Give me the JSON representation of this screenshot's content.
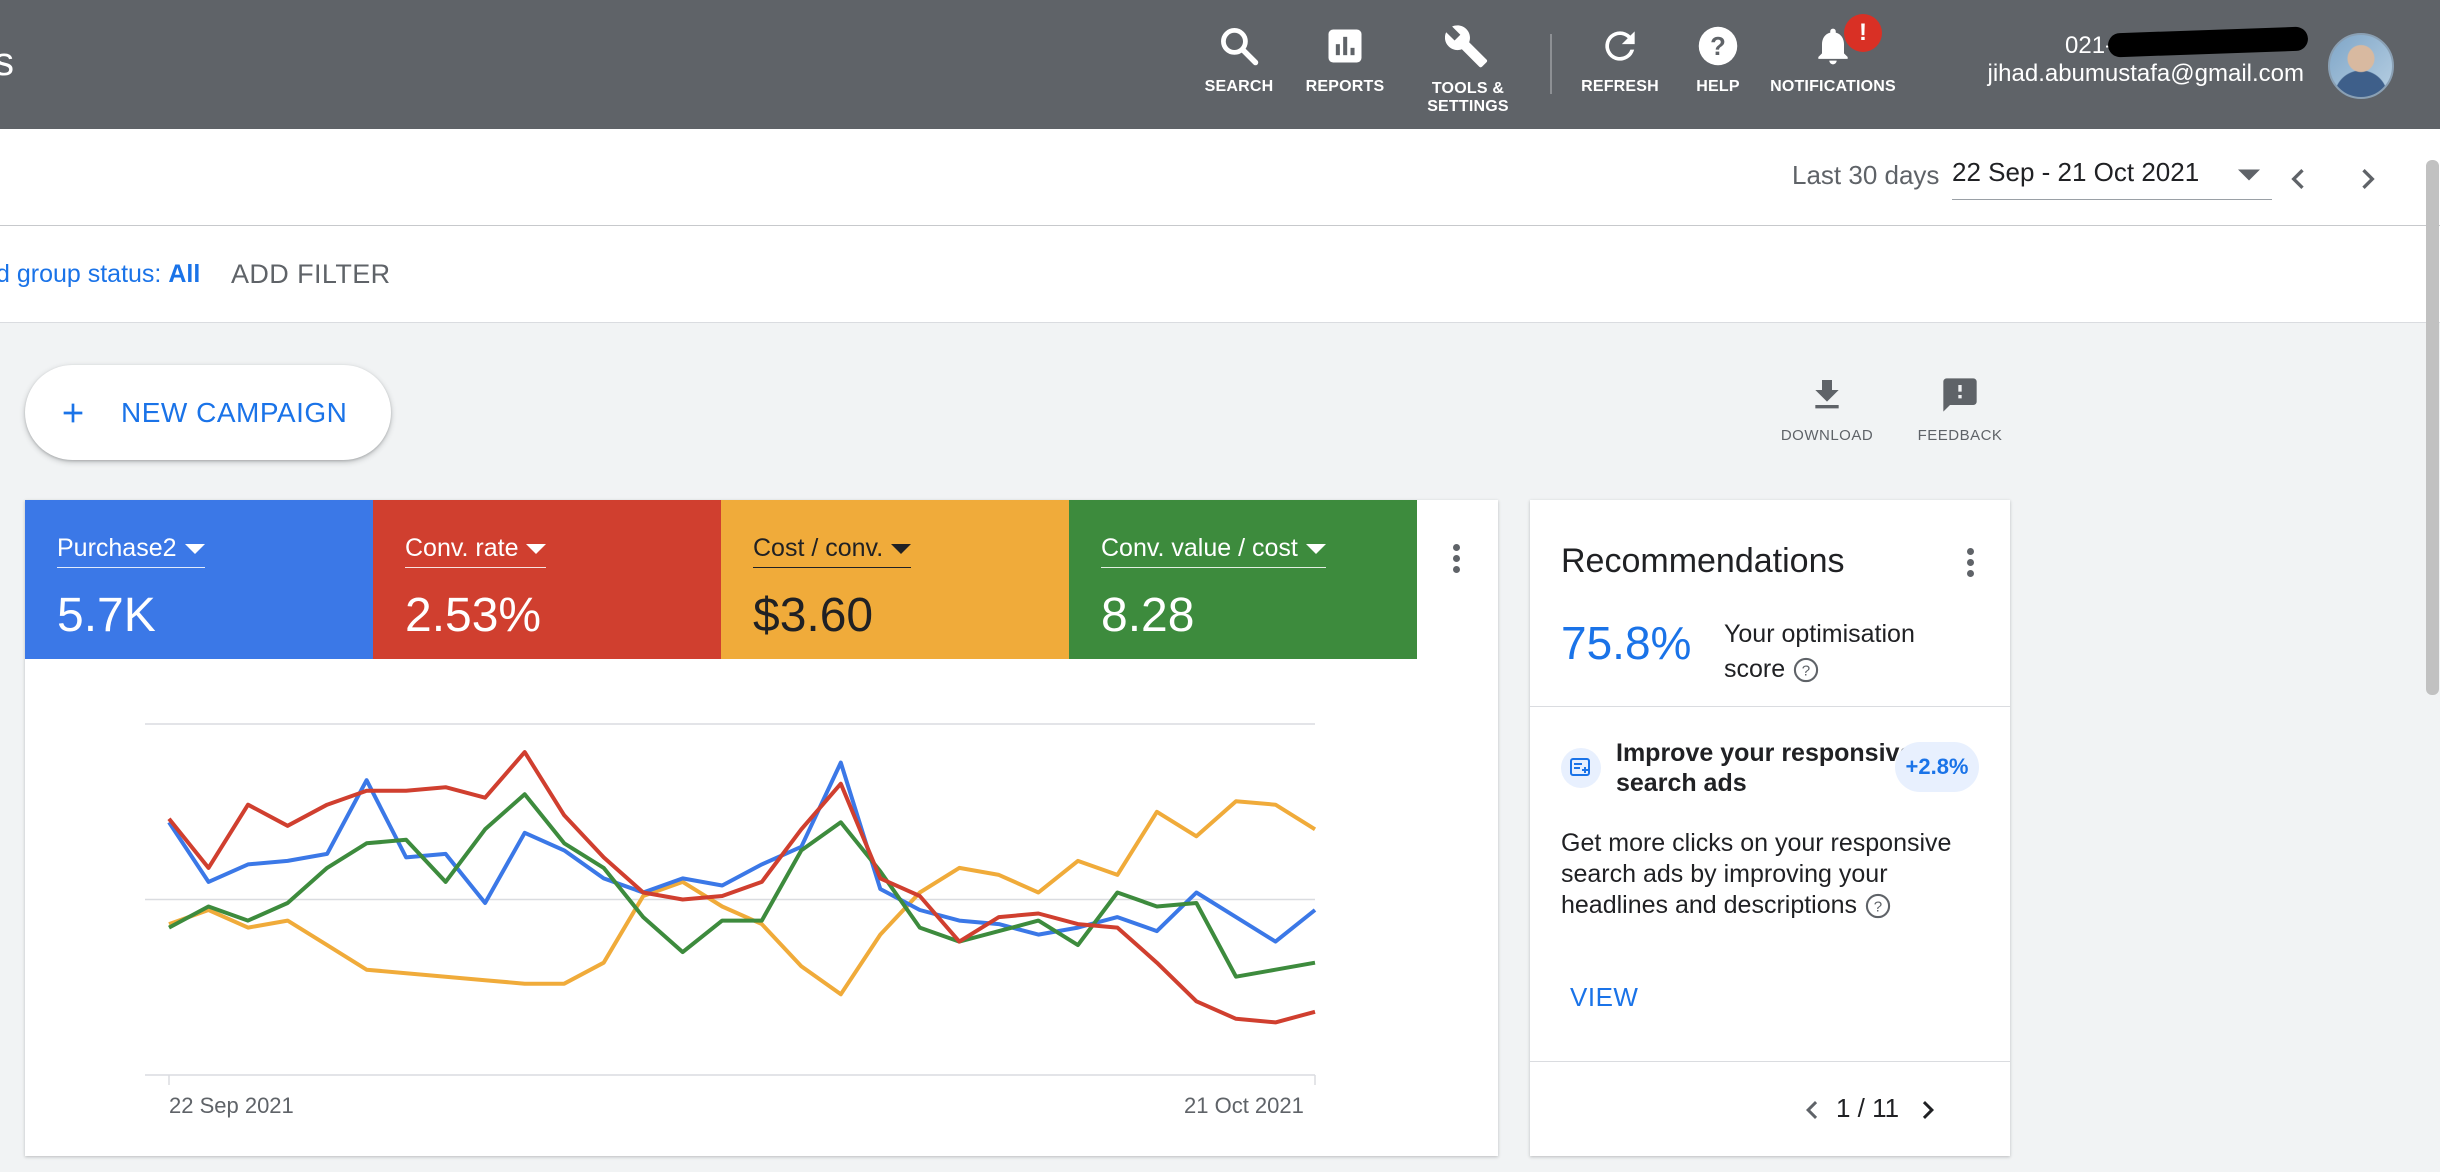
{
  "app": {
    "title_fragment": "s"
  },
  "topbar": {
    "items": [
      {
        "label": "SEARCH",
        "icon": "search-icon"
      },
      {
        "label": "REPORTS",
        "icon": "reports-icon"
      },
      {
        "label": "TOOLS &\nSETTINGS",
        "icon": "wrench-icon"
      },
      {
        "label": "REFRESH",
        "icon": "refresh-icon"
      },
      {
        "label": "HELP",
        "icon": "help-icon"
      },
      {
        "label": "NOTIFICATIONS",
        "icon": "bell-icon",
        "badge": "!"
      }
    ],
    "account_id": "021-667-",
    "account_email": "jihad.abumustafa@gmail.com"
  },
  "date": {
    "preset": "Last 30 days",
    "range": "22 Sep - 21 Oct 2021"
  },
  "filter": {
    "chip_label": "d group status: ",
    "chip_value": "All",
    "add_label": "ADD FILTER"
  },
  "actions": {
    "new_campaign": "NEW CAMPAIGN",
    "download": "DOWNLOAD",
    "feedback": "FEEDBACK"
  },
  "metrics": [
    {
      "label": "Purchase2",
      "value": "5.7K",
      "color": "#3b78e7"
    },
    {
      "label": "Conv. rate",
      "value": "2.53%",
      "color": "#d03f2f"
    },
    {
      "label": "Cost / conv.",
      "value": "$3.60",
      "color": "#f0ab3a"
    },
    {
      "label": "Conv. value / cost",
      "value": "8.28",
      "color": "#3d8b3d"
    }
  ],
  "chart_data": {
    "type": "line",
    "x_start": "22 Sep 2021",
    "x_end": "21 Oct 2021",
    "x": [
      1,
      2,
      3,
      4,
      5,
      6,
      7,
      8,
      9,
      10,
      11,
      12,
      13,
      14,
      15,
      16,
      17,
      18,
      19,
      20,
      21,
      22,
      23,
      24,
      25,
      26,
      27,
      28,
      29,
      30
    ],
    "grid": true,
    "series": [
      {
        "name": "Purchase2",
        "color": "#3b78e7",
        "values": [
          72,
          55,
          60,
          61,
          63,
          84,
          62,
          63,
          49,
          69,
          64,
          56,
          52,
          56,
          54,
          60,
          65,
          89,
          53,
          47,
          44,
          43,
          40,
          42,
          45,
          41,
          52,
          45,
          38,
          47
        ]
      },
      {
        "name": "Conv. rate",
        "color": "#d03f2f",
        "values": [
          73,
          59,
          77,
          71,
          77,
          81,
          81,
          82,
          79,
          92,
          74,
          62,
          52,
          50,
          51,
          55,
          70,
          83,
          56,
          51,
          38,
          45,
          46,
          43,
          42,
          32,
          21,
          16,
          15,
          18
        ]
      },
      {
        "name": "Cost / conv.",
        "color": "#f0ab3a",
        "values": [
          43,
          47,
          42,
          44,
          37,
          30,
          29,
          28,
          27,
          26,
          26,
          32,
          51,
          55,
          48,
          43,
          31,
          23,
          40,
          52,
          59,
          57,
          52,
          61,
          57,
          75,
          68,
          78,
          77,
          70
        ]
      },
      {
        "name": "Conv. value / cost",
        "color": "#3d8b3d",
        "values": [
          42,
          48,
          44,
          49,
          59,
          66,
          67,
          55,
          70,
          80,
          66,
          59,
          45,
          35,
          44,
          44,
          64,
          72,
          58,
          42,
          38,
          41,
          44,
          37,
          52,
          48,
          49,
          28,
          30,
          32
        ]
      }
    ]
  },
  "recommendations": {
    "title": "Recommendations",
    "score": "75.8%",
    "score_label": "Your optimisation score",
    "item_title": "Improve your responsive search ads",
    "item_badge": "+2.8%",
    "item_desc": "Get more clicks on your responsive search ads by improving your headlines and descriptions",
    "view_label": "VIEW",
    "pager": "1 / 11"
  }
}
